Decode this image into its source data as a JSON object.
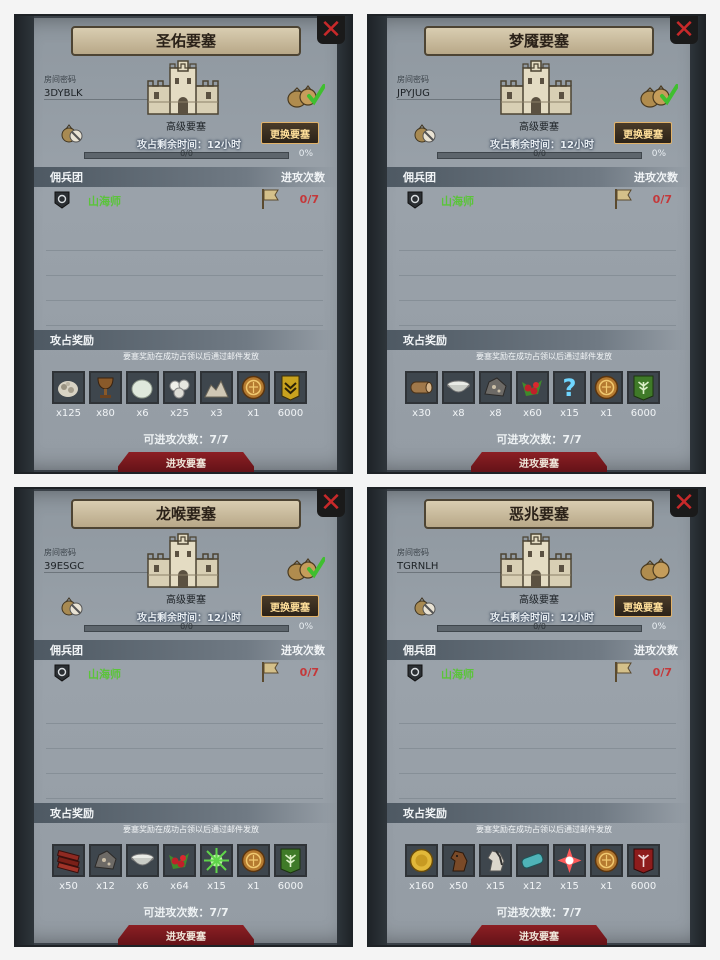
{
  "panels": [
    {
      "title": "圣佑要塞",
      "room_code_label": "房间密码",
      "room_code": "3DYBLK",
      "fortress_level": "高级要塞",
      "remaining_time": "攻占剩余时间：12小时",
      "change_button": "更换要塞",
      "progress_text": "0/0",
      "progress_percent": "0%",
      "progress_value": 0,
      "mercenary_header": "佣兵团",
      "attack_count_header": "进攻次数",
      "mercenary_name": "山海师",
      "attack_count": "0/7",
      "reward_header": "攻占奖励",
      "reward_note": "要塞奖励在成功占领以后通过邮件发放",
      "bag_checked": true,
      "rewards": [
        {
          "icon": "ore-icon",
          "count": "x125"
        },
        {
          "icon": "chalice-icon",
          "count": "x80"
        },
        {
          "icon": "stone-icon",
          "count": "x6"
        },
        {
          "icon": "pearls-icon",
          "count": "x25"
        },
        {
          "icon": "rock-pile-icon",
          "count": "x3"
        },
        {
          "icon": "coin-icon",
          "count": "x1"
        },
        {
          "icon": "banner-emblem-icon",
          "count": "6000"
        }
      ],
      "attempts_left": "可进攻次数：7/7",
      "attack_button": "进攻要塞"
    },
    {
      "title": "梦魇要塞",
      "room_code_label": "房间密码",
      "room_code": "JPYJUG",
      "fortress_level": "高级要塞",
      "remaining_time": "攻占剩余时间：12小时",
      "change_button": "更换要塞",
      "progress_text": "0/0",
      "progress_percent": "0%",
      "progress_value": 0,
      "mercenary_header": "佣兵团",
      "attack_count_header": "进攻次数",
      "mercenary_name": "山海师",
      "attack_count": "0/7",
      "reward_header": "攻占奖励",
      "reward_note": "要塞奖励在成功占领以后通过邮件发放",
      "bag_checked": true,
      "rewards": [
        {
          "icon": "log-icon",
          "count": "x30"
        },
        {
          "icon": "bowl-icon",
          "count": "x8"
        },
        {
          "icon": "ore-rock-icon",
          "count": "x8"
        },
        {
          "icon": "berries-icon",
          "count": "x60"
        },
        {
          "icon": "question-icon",
          "count": "x15"
        },
        {
          "icon": "coin-icon",
          "count": "x1"
        },
        {
          "icon": "tree-banner-icon",
          "count": "6000"
        }
      ],
      "attempts_left": "可进攻次数：7/7",
      "attack_button": "进攻要塞"
    },
    {
      "title": "龙喉要塞",
      "room_code_label": "房间密码",
      "room_code": "39ESGC",
      "fortress_level": "高级要塞",
      "remaining_time": "攻占剩余时间：12小时",
      "change_button": "更换要塞",
      "progress_text": "0/0",
      "progress_percent": "0%",
      "progress_value": 0,
      "mercenary_header": "佣兵团",
      "attack_count_header": "进攻次数",
      "mercenary_name": "山海师",
      "attack_count": "0/7",
      "reward_header": "攻占奖励",
      "reward_note": "要塞奖励在成功占领以后通过邮件发放",
      "bag_checked": true,
      "rewards": [
        {
          "icon": "planks-icon",
          "count": "x50"
        },
        {
          "icon": "ore-rock-icon",
          "count": "x12"
        },
        {
          "icon": "bowl-icon",
          "count": "x6"
        },
        {
          "icon": "berries-icon",
          "count": "x64"
        },
        {
          "icon": "green-burst-icon",
          "count": "x15"
        },
        {
          "icon": "coin-icon",
          "count": "x1"
        },
        {
          "icon": "tree-banner-icon",
          "count": "6000"
        }
      ],
      "attempts_left": "可进攻次数：7/7",
      "attack_button": "进攻要塞"
    },
    {
      "title": "恶兆要塞",
      "room_code_label": "房间密码",
      "room_code": "TGRNLH",
      "fortress_level": "高级要塞",
      "remaining_time": "攻占剩余时间：12小时",
      "change_button": "更换要塞",
      "progress_text": "0/0",
      "progress_percent": "0%",
      "progress_value": 0,
      "mercenary_header": "佣兵团",
      "attack_count_header": "进攻次数",
      "mercenary_name": "山海师",
      "attack_count": "0/7",
      "reward_header": "攻占奖励",
      "reward_note": "要塞奖励在成功占领以后通过邮件发放",
      "bag_checked": false,
      "rewards": [
        {
          "icon": "gold-coin-icon",
          "count": "x160"
        },
        {
          "icon": "horse-icon",
          "count": "x50"
        },
        {
          "icon": "white-horse-icon",
          "count": "x15"
        },
        {
          "icon": "cloth-roll-icon",
          "count": "x12"
        },
        {
          "icon": "red-star-icon",
          "count": "x15"
        },
        {
          "icon": "coin-icon",
          "count": "x1"
        },
        {
          "icon": "red-banner-icon",
          "count": "6000"
        }
      ],
      "attempts_left": "可进攻次数：7/7",
      "attack_button": "进攻要塞"
    }
  ]
}
